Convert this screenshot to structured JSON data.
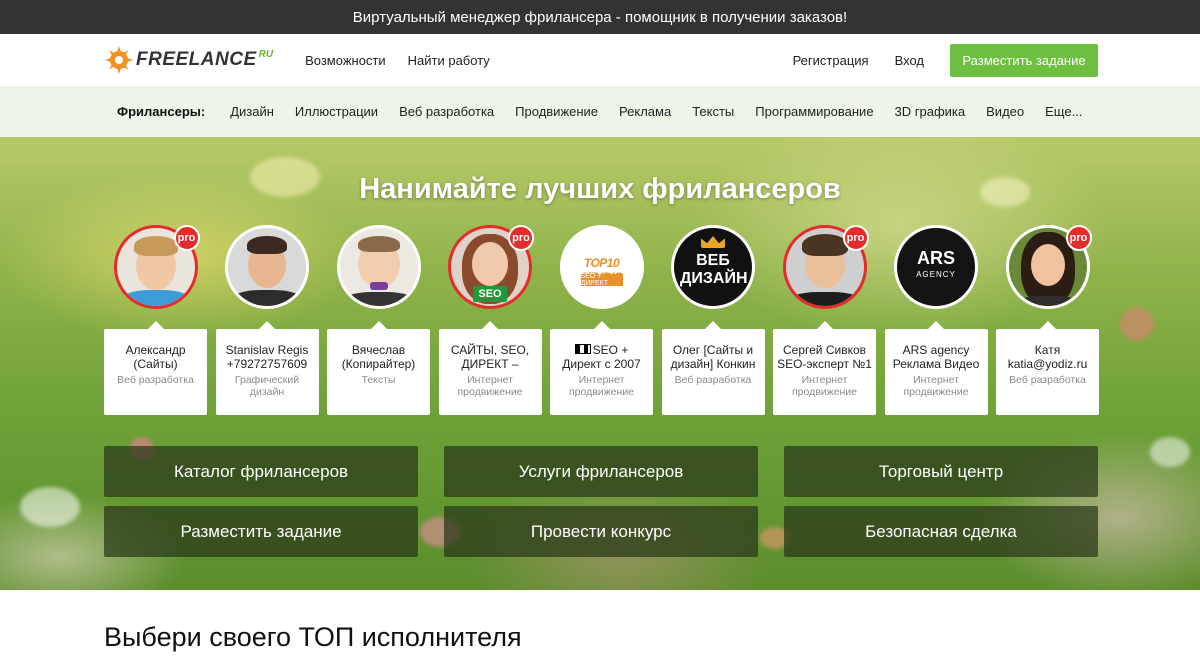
{
  "banner": {
    "text": "Виртуальный менеджер фрилансера - помощник в получении заказов!"
  },
  "header": {
    "logo_text": "FREELANCE",
    "logo_suffix": "RU",
    "nav": [
      "Возможности",
      "Найти работу"
    ],
    "register_label": "Регистрация",
    "login_label": "Вход",
    "post_task_label": "Разместить задание"
  },
  "categories": {
    "title": "Фрилансеры:",
    "items": [
      "Дизайн",
      "Иллюстрации",
      "Веб разработка",
      "Продвижение",
      "Реклама",
      "Тексты",
      "Программирование",
      "3D графика",
      "Видео",
      "Еще..."
    ]
  },
  "hero": {
    "title": "Нанимайте лучших фрилансеров",
    "pro_label": "pro",
    "freelancers": [
      {
        "name": "Александр (Сайты)",
        "category": "Веб разработка",
        "pro": true
      },
      {
        "name": "Stanislav Regis +79272757609",
        "category": "Графический дизайн",
        "pro": false
      },
      {
        "name": "Вячеслав (Копирайтер)",
        "category": "Тексты",
        "pro": false
      },
      {
        "name": "САЙТЫ, SEO, ДИРЕКТ –",
        "category": "Интернет продвижение",
        "pro": true,
        "avatar_text": "SEO"
      },
      {
        "name": "SEO + Директ с 2007",
        "category": "Интернет продвижение",
        "pro": false,
        "avatar_text": "TOP10 STUDIO",
        "avatar_sub": "SEO + ДИРЕКТ"
      },
      {
        "name": "Олег [Сайты и дизайн] Конкин",
        "category": "Веб разработка",
        "pro": false,
        "avatar_text": "ВЕБ ДИЗАЙН"
      },
      {
        "name": "Сергей Сивков SEO-эксперт №1",
        "category": "Интернет продвижение",
        "pro": true
      },
      {
        "name": "ARS agency Реклама Видео",
        "category": "Интернет продвижение",
        "pro": false,
        "avatar_text": "ARS",
        "avatar_sub": "AGENCY"
      },
      {
        "name": "Катя katia@yodiz.ru",
        "category": "Веб разработка",
        "pro": true
      }
    ],
    "tiles": [
      "Каталог фрилансеров",
      "Услуги фрилансеров",
      "Торговый центр",
      "Разместить задание",
      "Провести конкурс",
      "Безопасная сделка"
    ]
  },
  "bottom": {
    "title": "Выбери своего ТОП исполнителя"
  },
  "colors": {
    "accent": "#6cbf3f",
    "pro": "#e52b2b",
    "banner": "#333333",
    "catbar": "#eef4e8"
  }
}
